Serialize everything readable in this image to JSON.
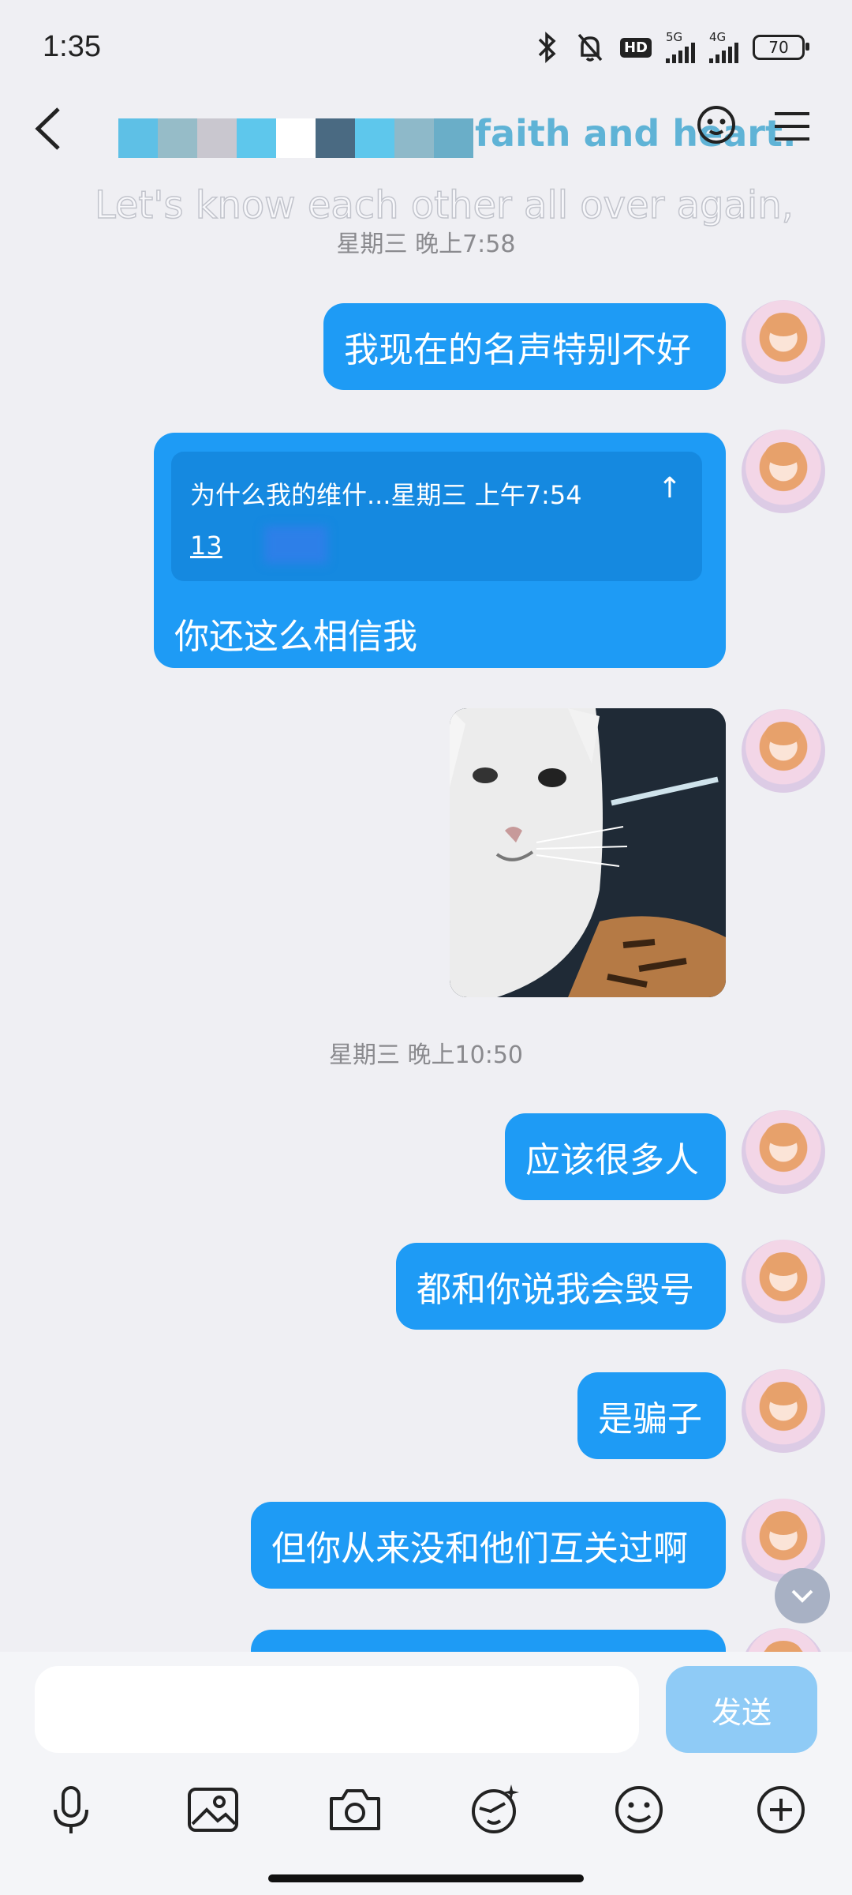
{
  "status_bar": {
    "time": "1:35",
    "network_5g": "5G",
    "network_4g": "4G",
    "hd_label": "HD",
    "battery": "70"
  },
  "header": {
    "banner_main": "faith and heart.",
    "banner_sub": "Let's know each other all over again,"
  },
  "messages": {
    "t1": "星期三 晚上7:58",
    "m1": "我现在的名声特别不好",
    "quote_text": "为什么我的维什...星期三 上午7:54",
    "quote_num": "13",
    "quote_reply": "你还这么相信我",
    "t2": "星期三 晚上10:50",
    "m2": "应该很多人",
    "m3": "都和你说我会毁号",
    "m4": "是骗子",
    "m5": "但你从来没和他们互关过啊"
  },
  "input": {
    "placeholder": "",
    "send_label": "发送"
  },
  "icons": {
    "toolbar": [
      "microphone-icon",
      "image-icon",
      "camera-icon",
      "sticker-icon",
      "emoji-icon",
      "plus-icon"
    ]
  },
  "colors": {
    "bubble": "#1e9bf5",
    "send_disabled": "#8fcbf6",
    "background": "#efeff3"
  }
}
